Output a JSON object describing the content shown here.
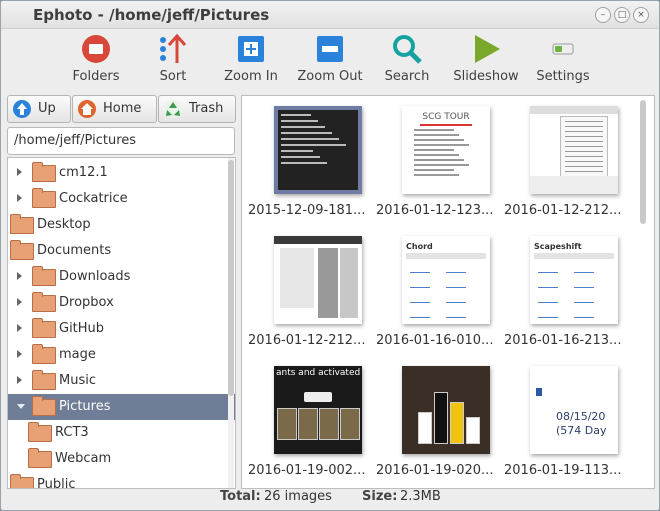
{
  "window": {
    "title": "Ephoto - /home/jeff/Pictures"
  },
  "toolbar": [
    {
      "label": "Folders",
      "icon": "folders-icon"
    },
    {
      "label": "Sort",
      "icon": "sort-icon"
    },
    {
      "label": "Zoom In",
      "icon": "zoom-in-icon"
    },
    {
      "label": "Zoom Out",
      "icon": "zoom-out-icon"
    },
    {
      "label": "Search",
      "icon": "search-icon"
    },
    {
      "label": "Slideshow",
      "icon": "slideshow-icon"
    },
    {
      "label": "Settings",
      "icon": "settings-icon"
    }
  ],
  "nav": {
    "up_label": "Up",
    "home_label": "Home",
    "trash_label": "Trash"
  },
  "path": {
    "value": "/home/jeff/Pictures"
  },
  "tree": [
    {
      "label": "cm12.1",
      "expander": true
    },
    {
      "label": "Cockatrice",
      "expander": true
    },
    {
      "label": "Desktop",
      "expander": false
    },
    {
      "label": "Documents",
      "expander": false
    },
    {
      "label": "Downloads",
      "expander": true
    },
    {
      "label": "Dropbox",
      "expander": true
    },
    {
      "label": "GitHub",
      "expander": true
    },
    {
      "label": "mage",
      "expander": true
    },
    {
      "label": "Music",
      "expander": true
    },
    {
      "label": "Pictures",
      "expander": true,
      "selected": true
    },
    {
      "label": "RCT3",
      "expander": false
    },
    {
      "label": "Webcam",
      "expander": false
    },
    {
      "label": "Public",
      "expander": false
    }
  ],
  "grid": [
    {
      "caption": "2015-12-09-181...",
      "kind": "terminal"
    },
    {
      "caption": "2016-01-12-123...",
      "kind": "document",
      "text": "SCG TOUR"
    },
    {
      "caption": "2016-01-12-212...",
      "kind": "menu"
    },
    {
      "caption": "2016-01-12-212...",
      "kind": "panel"
    },
    {
      "caption": "2016-01-16-010...",
      "kind": "webpage",
      "text": "Chord"
    },
    {
      "caption": "2016-01-16-213...",
      "kind": "webpage",
      "text": "Scapeshift"
    },
    {
      "caption": "2016-01-19-002...",
      "kind": "game",
      "text": "ants and activated a"
    },
    {
      "caption": "2016-01-19-020...",
      "kind": "bars"
    },
    {
      "caption": "2016-01-19-113...",
      "kind": "date",
      "text": "08/15/20",
      "text2": "(574 Day"
    }
  ],
  "status": {
    "total_label": "Total:",
    "total_value": "26 images",
    "size_label": "Size:",
    "size_value": "2.3MB"
  }
}
